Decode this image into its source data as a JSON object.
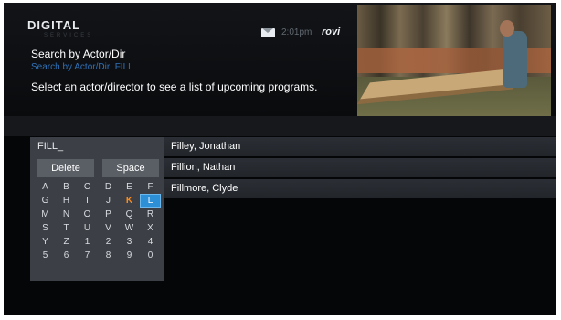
{
  "header": {
    "logo": "DIGITAL",
    "logo_sub": "SERVICES",
    "time": "2:01pm",
    "brand": "rovi",
    "title": "Search by Actor/Dir",
    "breadcrumb": "Search by Actor/Dir: FILL",
    "instruction": "Select an actor/director to see a list of upcoming programs."
  },
  "keyboard": {
    "entry": "FILL_",
    "delete_label": "Delete",
    "space_label": "Space",
    "keys": [
      "A",
      "B",
      "C",
      "D",
      "E",
      "F",
      "G",
      "H",
      "I",
      "J",
      "K",
      "L",
      "M",
      "N",
      "O",
      "P",
      "Q",
      "R",
      "S",
      "T",
      "U",
      "V",
      "W",
      "X",
      "Y",
      "Z",
      "1",
      "2",
      "3",
      "4",
      "5",
      "6",
      "7",
      "8",
      "9",
      "0"
    ],
    "selected_key": "L",
    "highlighted_key": "K"
  },
  "results": [
    "Filley, Jonathan",
    "Fillion, Nathan",
    "Fillmore, Clyde"
  ]
}
